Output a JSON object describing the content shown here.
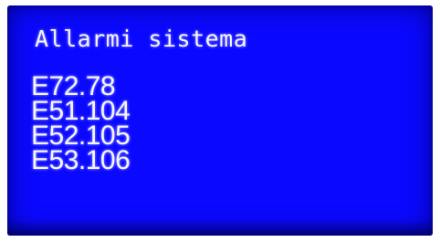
{
  "screen": {
    "background_color": "#0a08ff",
    "text_color": "#f4f4ff",
    "title": "Allarmi sistema",
    "alarms": [
      "E72.78",
      "E51.104",
      "E52.105",
      "E53.106"
    ]
  }
}
